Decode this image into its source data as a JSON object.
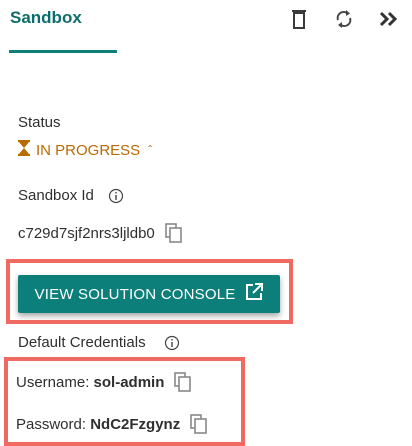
{
  "panel": {
    "tab_title": "Sandbox",
    "icons": [
      "trash-icon",
      "refresh-icon",
      "collapse-chevrons-icon"
    ]
  },
  "status": {
    "label": "Status",
    "value": "IN PROGRESS",
    "marker": "ˆ",
    "color": "#b96a00"
  },
  "sandbox_id": {
    "label": "Sandbox Id",
    "value": "c729d7sjf2nrs3ljldb0"
  },
  "console_button": {
    "label": "VIEW SOLUTION CONSOLE"
  },
  "credentials": {
    "label": "Default Credentials",
    "username_label": "Username:",
    "username_value": "sol-admin",
    "password_label": "Password:",
    "password_value": "NdC2Fzgynz"
  },
  "colors": {
    "accent": "#0c7f7b",
    "highlight": "#f06a62",
    "status": "#b96a00"
  }
}
